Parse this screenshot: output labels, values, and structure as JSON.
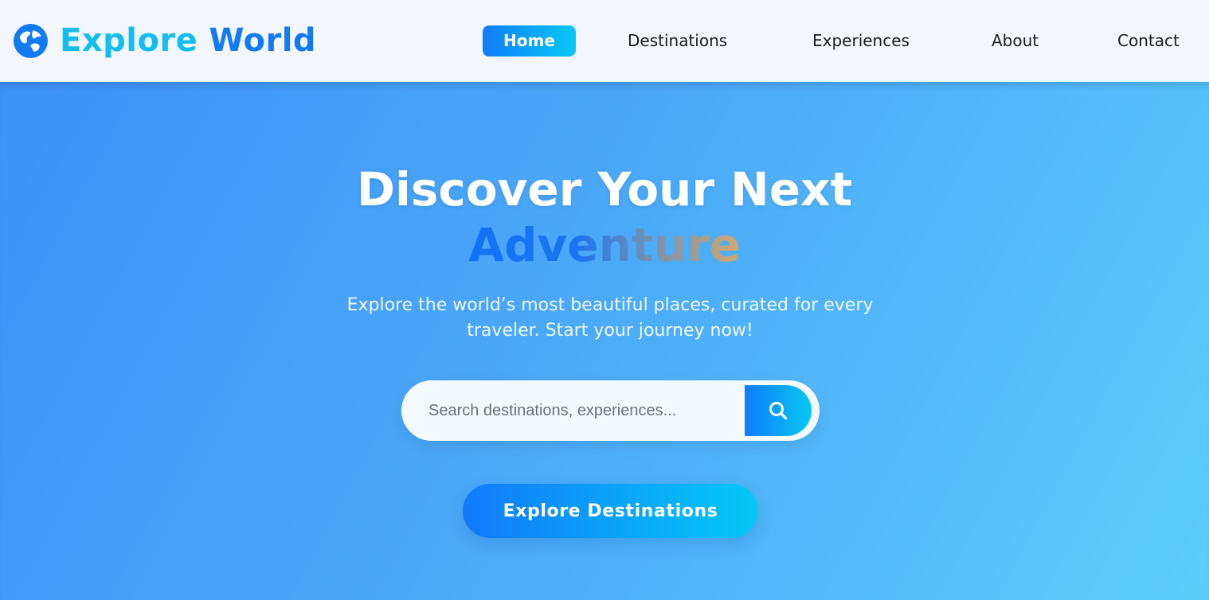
{
  "header": {
    "brand": {
      "word1": "Explore",
      "word2": "World",
      "icon": "globe-icon"
    },
    "nav": [
      {
        "label": "Home",
        "active": true
      },
      {
        "label": "Destinations"
      },
      {
        "label": "Experiences"
      },
      {
        "label": "About"
      },
      {
        "label": "Contact"
      }
    ]
  },
  "hero": {
    "title_line1": "Discover Your Next",
    "title_line2": "Adventure",
    "subtitle": "Explore the world’s most beautiful places, curated for every traveler. Start your journey now!",
    "search": {
      "placeholder": "Search destinations, experiences...",
      "value": "",
      "button_icon": "search-icon"
    },
    "cta_label": "Explore Destinations"
  },
  "colors": {
    "accent": "#137bf2",
    "accent_light": "#13bdf0",
    "hero_gradient_start": "#3d92f6",
    "hero_gradient_end": "#5ccdfb"
  }
}
